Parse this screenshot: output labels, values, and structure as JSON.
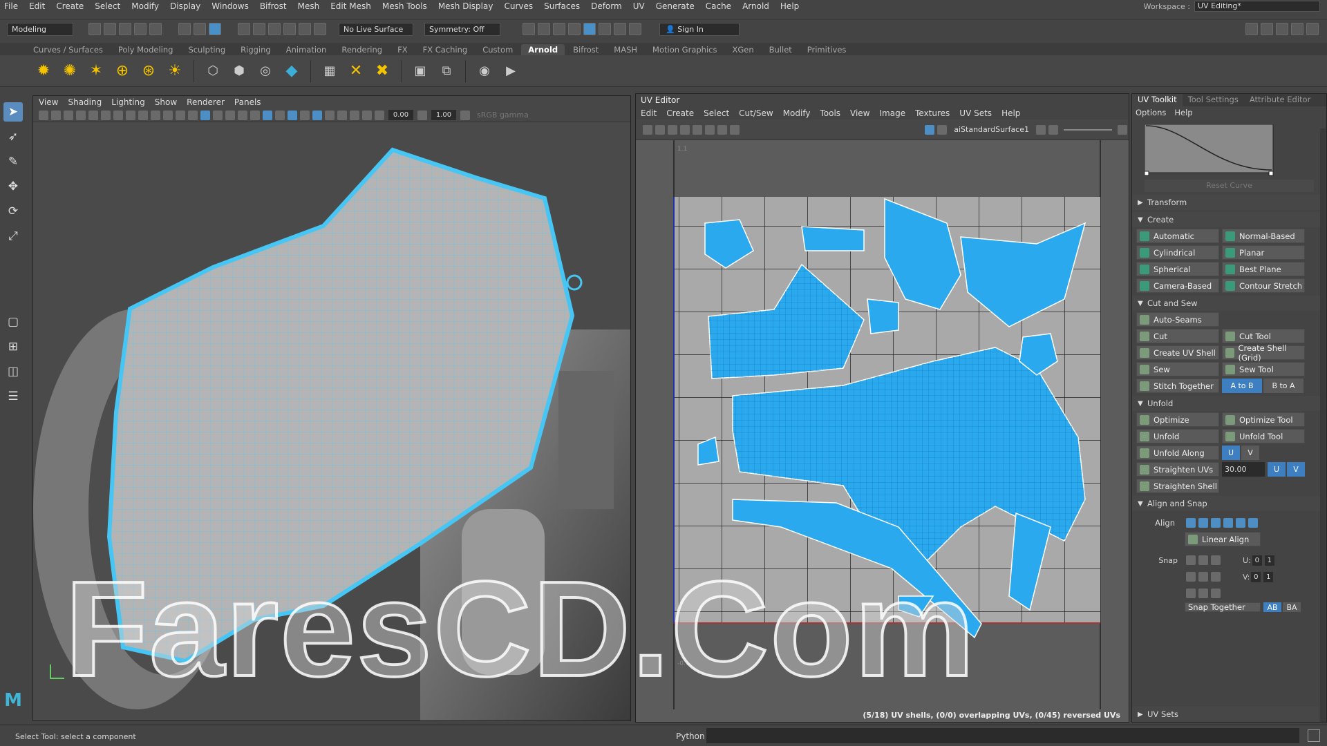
{
  "menubar": {
    "items": [
      "File",
      "Edit",
      "Create",
      "Select",
      "Modify",
      "Display",
      "Windows",
      "Bifrost",
      "Mesh",
      "Edit Mesh",
      "Mesh Tools",
      "Mesh Display",
      "Curves",
      "Surfaces",
      "Deform",
      "UV",
      "Generate",
      "Cache",
      "Arnold",
      "Help"
    ],
    "workspace_label": "Workspace :",
    "workspace_value": "UV Editing*"
  },
  "statusline": {
    "mode": "Modeling",
    "live_surface": "No Live Surface",
    "symmetry": "Symmetry: Off",
    "sign_in": "Sign In"
  },
  "shelf": {
    "tabs": [
      "Curves / Surfaces",
      "Poly Modeling",
      "Sculpting",
      "Rigging",
      "Animation",
      "Rendering",
      "FX",
      "FX Caching",
      "Custom",
      "Arnold",
      "Bifrost",
      "MASH",
      "Motion Graphics",
      "XGen",
      "Bullet",
      "Primitives"
    ],
    "active_tab": "Arnold"
  },
  "viewport": {
    "menu": [
      "View",
      "Shading",
      "Lighting",
      "Show",
      "Renderer",
      "Panels"
    ],
    "field1": "0.00",
    "field2": "1.00",
    "gamma": "sRGB gamma"
  },
  "uv_editor": {
    "title": "UV Editor",
    "menu": [
      "Edit",
      "Create",
      "Select",
      "Cut/Sew",
      "Modify",
      "Tools",
      "View",
      "Image",
      "Textures",
      "UV Sets",
      "Help"
    ],
    "material": "aiStandardSurface1",
    "status": "(5/18) UV shells, (0/0) overlapping UVs, (0/45) reversed UVs",
    "tick_top": "1.1",
    "tick_bottom": "-0.1"
  },
  "toolkit": {
    "tabs": [
      "UV Toolkit",
      "Tool Settings",
      "Attribute Editor"
    ],
    "menu": [
      "Options",
      "Help"
    ],
    "reset_curve": "Reset Curve",
    "sections": {
      "transform": "Transform",
      "create": "Create",
      "cut_sew": "Cut and Sew",
      "unfold": "Unfold",
      "align_snap": "Align and Snap",
      "uv_sets": "UV Sets"
    },
    "create_buttons": [
      "Automatic",
      "Normal-Based",
      "Cylindrical",
      "Planar",
      "Spherical",
      "Best Plane",
      "Camera-Based",
      "Contour Stretch"
    ],
    "cut_buttons": {
      "auto_seams": "Auto-Seams",
      "cut": "Cut",
      "cut_tool": "Cut Tool",
      "create_uv_shell": "Create UV Shell",
      "create_shell_grid": "Create Shell (Grid)",
      "sew": "Sew",
      "sew_tool": "Sew Tool",
      "stitch_together": "Stitch Together",
      "a_to_b": "A to B",
      "b_to_a": "B to A"
    },
    "unfold_buttons": {
      "optimize": "Optimize",
      "optimize_tool": "Optimize Tool",
      "unfold": "Unfold",
      "unfold_tool": "Unfold Tool",
      "unfold_along": "Unfold Along",
      "u": "U",
      "v": "V",
      "straighten_uvs": "Straighten UVs",
      "straighten_value": "30.00",
      "straighten_shell": "Straighten Shell"
    },
    "align": {
      "label": "Align",
      "linear_align": "Linear Align",
      "snap_label": "Snap",
      "u_label": "U:",
      "v_label": "V:",
      "u_val0": "0",
      "u_val1": "1",
      "v_val0": "0",
      "v_val1": "1",
      "snap_together": "Snap Together",
      "ab": "AB",
      "ba": "BA"
    }
  },
  "bottom": {
    "help_line": "Select Tool: select a component",
    "python": "Python"
  },
  "watermark": "FaresCD.Com",
  "colors": {
    "uv_blue": "#29a8ef",
    "accent": "#4a90c8"
  }
}
